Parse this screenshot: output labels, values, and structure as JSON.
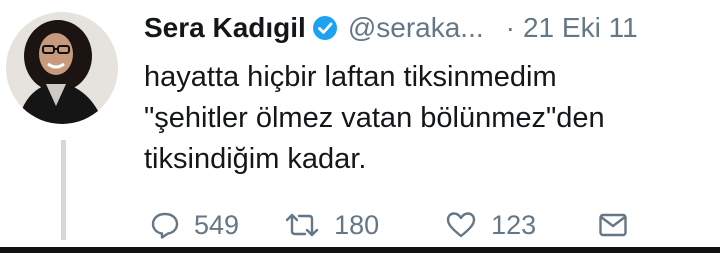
{
  "tweet": {
    "author_name": "Sera Kadıgil",
    "handle": "@seraka...",
    "separator": "·",
    "date": "21 Eki 11",
    "text_lines": [
      "hayatta hiçbir laftan tiksinmedim",
      "\"şehitler ölmez vatan bölünmez\"den",
      "tiksindiğim kadar."
    ],
    "replies": "549",
    "retweets": "180",
    "likes": "123"
  },
  "icons": {
    "verified": "verified-badge-icon",
    "reply": "reply-icon",
    "retweet": "retweet-icon",
    "like": "heart-icon",
    "dm": "envelope-icon"
  },
  "colors": {
    "text": "#14171a",
    "secondary": "#657786",
    "verified": "#1da1f2"
  }
}
